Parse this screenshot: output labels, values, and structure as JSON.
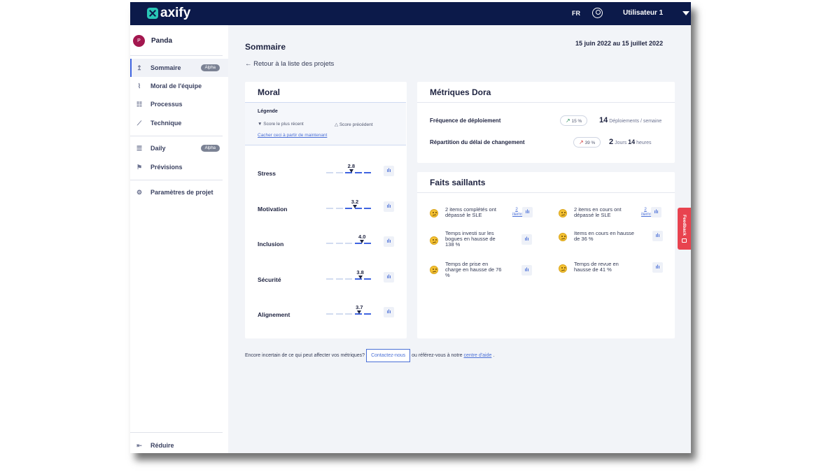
{
  "topbar": {
    "logo": "axify",
    "language": "FR",
    "user": "Utilisateur 1"
  },
  "sidebar": {
    "project_initial": "P",
    "project_name": "Panda",
    "items": [
      {
        "label": "Sommaire",
        "badge": "Alpha",
        "icon": "pin-icon"
      },
      {
        "label": "Moral de l'équipe",
        "icon": "pulse-icon"
      },
      {
        "label": "Processus",
        "icon": "process-icon"
      },
      {
        "label": "Technique",
        "icon": "trend-icon"
      },
      {
        "label": "Daily",
        "badge": "Alpha",
        "icon": "daily-icon"
      },
      {
        "label": "Prévisions",
        "icon": "flag-icon"
      },
      {
        "label": "Paramètres de projet",
        "icon": "gear-icon"
      }
    ],
    "collapse_label": "Réduire"
  },
  "main": {
    "title": "Sommaire",
    "date_range": "15 juin 2022 au 15 juillet 2022",
    "back_label": "Retour à la liste des projets"
  },
  "moral": {
    "title": "Moral",
    "legend_title": "Légende",
    "legend_recent": "Score le plus récent",
    "legend_previous": "Score précédent",
    "legend_hide": "Cacher ceci à partir de maintenant",
    "scale_max": 5,
    "metrics": [
      {
        "label": "Stress",
        "score": "2.8",
        "value": 2.8
      },
      {
        "label": "Motivation",
        "score": "3.2",
        "value": 3.2
      },
      {
        "label": "Inclusion",
        "score": "4.0",
        "value": 4.0
      },
      {
        "label": "Sécurité",
        "score": "3.8",
        "value": 3.8
      },
      {
        "label": "Alignement",
        "score": "3.7",
        "value": 3.7
      }
    ]
  },
  "dora": {
    "title": "Métriques Dora",
    "rows": [
      {
        "label": "Fréquence de déploiement",
        "trend": "15 %",
        "trend_color": "#2a8c5a",
        "value": "14",
        "unit": "Déploiements / semaine"
      },
      {
        "label": "Répartition du délai de changement",
        "trend": "39 %",
        "trend_color": "#d23a3a",
        "value_days": "2",
        "unit_days": "Jours",
        "value_hours": "14",
        "unit_hours": "heures"
      }
    ]
  },
  "faits": {
    "title": "Faits saillants",
    "items": [
      {
        "text": "2 items complétés ont dépassé le SLE",
        "link": "2 items"
      },
      {
        "text": "2 items en cours ont dépassé le SLE",
        "link": "2 items"
      },
      {
        "text": "Temps investi sur les bogues en hausse de 138 %",
        "link": ""
      },
      {
        "text": "Items en cours en hausse de 36 %",
        "link": ""
      },
      {
        "text": "Temps de prise en charge en hausse de 76 %",
        "link": ""
      },
      {
        "text": "Temps de revue en hausse de 41 %",
        "link": ""
      }
    ]
  },
  "help": {
    "text_before": "Encore incertain de ce qui peut affecter vos métriques?",
    "button": "Contactez-nous",
    "text_after": "ou référez-vous à notre",
    "link": "centre d'aide",
    "period": "."
  },
  "feedback": "Feedback",
  "colors": {
    "navy": "#0c1a4a",
    "accent": "#3f64e0",
    "feedback": "#e8434f",
    "logo": "#29c6b6"
  }
}
